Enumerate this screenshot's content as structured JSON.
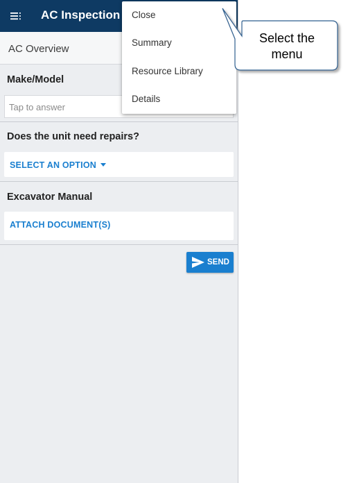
{
  "app": {
    "title": "AC Inspection F"
  },
  "overview": {
    "label": "AC Overview"
  },
  "make_model": {
    "label": "Make/Model",
    "placeholder": "Tap to answer"
  },
  "repairs": {
    "label": "Does the unit need repairs?",
    "select_label": "SELECT AN OPTION"
  },
  "manual": {
    "label": "Excavator Manual",
    "attach_label": "ATTACH DOCUMENT(S)"
  },
  "send_button": {
    "label": "SEND"
  },
  "menu": {
    "items": [
      {
        "label": "Close"
      },
      {
        "label": "Summary"
      },
      {
        "label": "Resource Library"
      },
      {
        "label": "Details"
      }
    ]
  },
  "callout": {
    "line1": "Select the",
    "line2": "menu"
  },
  "colors": {
    "appbar": "#0e3a63",
    "accent": "#1a7fcf",
    "background": "#eceef1"
  }
}
